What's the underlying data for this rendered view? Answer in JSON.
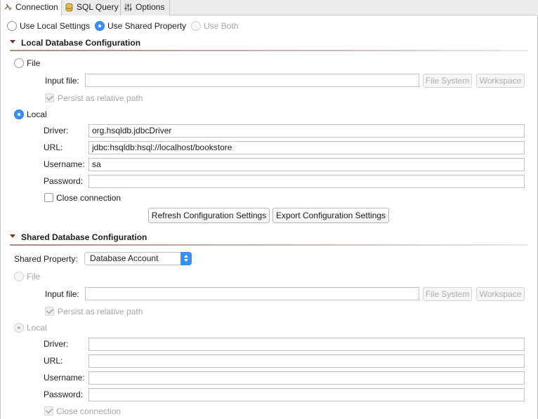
{
  "tabs": [
    {
      "label": "Connection",
      "icon": "connection-icon",
      "active": true
    },
    {
      "label": "SQL Query",
      "icon": "database-icon",
      "active": false
    },
    {
      "label": "Options",
      "icon": "options-icon",
      "active": false
    }
  ],
  "mode": {
    "local_settings": "Use Local Settings",
    "shared_property": "Use Shared Property",
    "use_both": "Use Both",
    "selected": "Use Shared Property"
  },
  "local": {
    "section_title": "Local Database Configuration",
    "file_label": "File",
    "input_file_label": "Input file:",
    "input_file_value": "",
    "file_system_button": "File System",
    "workspace_button": "Workspace",
    "persist_label": "Persist as relative path",
    "local_label": "Local",
    "selected": "Local",
    "driver_label": "Driver:",
    "driver_value": "org.hsqldb.jdbcDriver",
    "url_label": "URL:",
    "url_value": "jdbc:hsqldb:hsql://localhost/bookstore",
    "username_label": "Username:",
    "username_value": "sa",
    "password_label": "Password:",
    "password_value": "",
    "close_connection_label": "Close connection",
    "refresh_button": "Refresh Configuration Settings",
    "export_button": "Export Configuration Settings"
  },
  "shared": {
    "section_title": "Shared Database Configuration",
    "shared_property_label": "Shared Property:",
    "shared_property_value": "Database Account",
    "file_label": "File",
    "input_file_label": "Input file:",
    "input_file_value": "",
    "file_system_button": "File System",
    "workspace_button": "Workspace",
    "persist_label": "Persist as relative path",
    "local_label": "Local",
    "driver_label": "Driver:",
    "driver_value": "",
    "url_label": "URL:",
    "url_value": "",
    "username_label": "Username:",
    "username_value": "",
    "password_label": "Password:",
    "password_value": "",
    "close_connection_label": "Close connection"
  },
  "colors": {
    "accent": "#3b8ff0",
    "section_rule": "#a98a83",
    "disabled_text": "#a6a6a6"
  }
}
